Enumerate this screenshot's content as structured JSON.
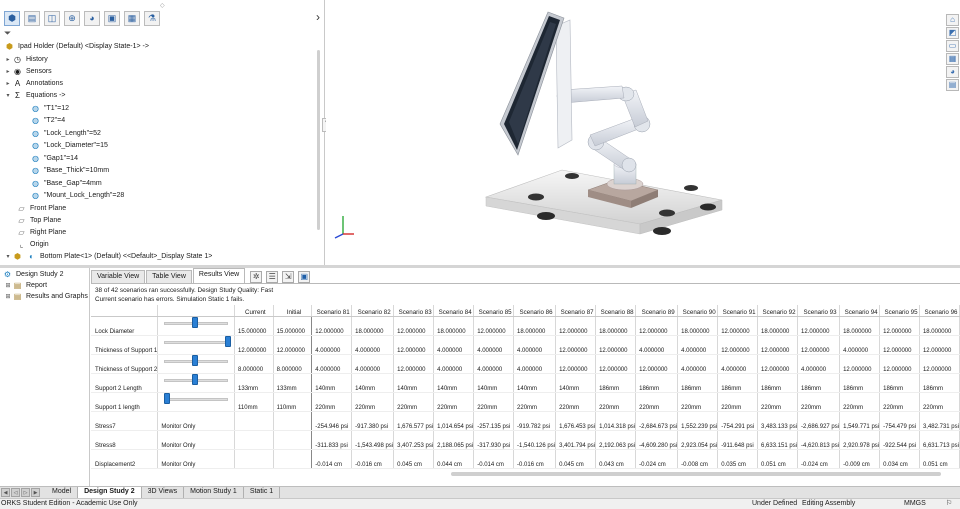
{
  "feature_manager": {
    "root_label": "Ipad Holder (Default) <Display State-1> ->",
    "nodes": [
      {
        "label": "History",
        "icon": "history-icon",
        "expandable": true
      },
      {
        "label": "Sensors",
        "icon": "sensors-icon",
        "expandable": true
      },
      {
        "label": "Annotations",
        "icon": "annotations-icon",
        "expandable": true
      },
      {
        "label": "Equations ->",
        "icon": "equations-icon",
        "expandable": true,
        "expanded": true
      }
    ],
    "equations": [
      "\"T1\"=12",
      "\"T2\"=4",
      "\"Lock_Length\"=52",
      "\"Lock_Diameter\"=15",
      "\"Gap1\"=14",
      "\"Base_Thick\"=10mm",
      "\"Base_Gap\"=4mm",
      "\"Mount_Lock_Length\"=28"
    ],
    "planes": [
      "Front Plane",
      "Top Plane",
      "Right Plane"
    ],
    "origin_label": "Origin",
    "component_label": "Bottom Plate<1> (Default) <<Default>_Display State 1>"
  },
  "study_tree": {
    "title": "Design Study 2",
    "items": [
      "Report",
      "Results and Graphs"
    ]
  },
  "results": {
    "tabs": [
      "Variable View",
      "Table View",
      "Results View"
    ],
    "active_tab": "Results View",
    "status_line1": "38 of 42 scenarios ran successfully. Design Study Quality: Fast",
    "status_line2": "Current scenario has errors. Simulation Static 1 fails.",
    "columns": [
      "Current",
      "Initial",
      "Scenario 81",
      "Scenario 82",
      "Scenario 83",
      "Scenario 84",
      "Scenario 85",
      "Scenario 86",
      "Scenario 87",
      "Scenario 88",
      "Scenario 89",
      "Scenario 90",
      "Scenario 91",
      "Scenario 92",
      "Scenario 93",
      "Scenario 94",
      "Scenario 95",
      "Scenario 96"
    ],
    "rows": [
      {
        "name": "Lock Diameter",
        "slider_fraction": 0.45,
        "current": "15.000000",
        "initial": "15.000000",
        "values": [
          "12.000000",
          "18.000000",
          "12.000000",
          "18.000000",
          "12.000000",
          "18.000000",
          "12.000000",
          "18.000000",
          "12.000000",
          "18.000000",
          "12.000000",
          "18.000000",
          "12.000000",
          "18.000000",
          "12.000000",
          "18.000000"
        ]
      },
      {
        "name": "Thickness of Support 1",
        "slider_fraction": 1.0,
        "current": "12.000000",
        "initial": "12.000000",
        "values": [
          "4.000000",
          "4.000000",
          "12.000000",
          "4.000000",
          "4.000000",
          "4.000000",
          "12.000000",
          "12.000000",
          "4.000000",
          "4.000000",
          "12.000000",
          "12.000000",
          "12.000000",
          "4.000000",
          "12.000000",
          "12.000000"
        ]
      },
      {
        "name": "Thickness of Support 2",
        "slider_fraction": 0.45,
        "current": "8.000000",
        "initial": "8.000000",
        "values": [
          "4.000000",
          "4.000000",
          "12.000000",
          "4.000000",
          "4.000000",
          "4.000000",
          "12.000000",
          "12.000000",
          "12.000000",
          "4.000000",
          "4.000000",
          "12.000000",
          "4.000000",
          "12.000000",
          "12.000000",
          "12.000000"
        ]
      },
      {
        "name": "Support 2 Length",
        "slider_fraction": 0.45,
        "current": "133mm",
        "initial": "133mm",
        "values": [
          "140mm",
          "140mm",
          "140mm",
          "140mm",
          "140mm",
          "140mm",
          "140mm",
          "186mm",
          "186mm",
          "186mm",
          "186mm",
          "186mm",
          "186mm",
          "186mm",
          "186mm",
          "186mm"
        ]
      },
      {
        "name": "Support 1 length",
        "slider_fraction": 0.0,
        "current": "110mm",
        "initial": "110mm",
        "values": [
          "220mm",
          "220mm",
          "220mm",
          "220mm",
          "220mm",
          "220mm",
          "220mm",
          "220mm",
          "220mm",
          "220mm",
          "220mm",
          "220mm",
          "220mm",
          "220mm",
          "220mm",
          "220mm"
        ]
      },
      {
        "name": "Stress7",
        "monitor": "Monitor Only",
        "current": "",
        "initial": "",
        "values": [
          "-254.946 psi",
          "-917.380 psi",
          "1,676.577 psi",
          "1,014.654 psi",
          "-257.135 psi",
          "-919.782 psi",
          "1,676.453 psi",
          "1,014.318 psi",
          "-2,684.673 psi",
          "1,552.239 psi",
          "-754.291 psi",
          "3,483.133 psi",
          "-2,686.927 psi",
          "1,549.771 psi",
          "-754.479 psi",
          "3,482.731 psi"
        ]
      },
      {
        "name": "Stress8",
        "monitor": "Monitor Only",
        "current": "",
        "initial": "",
        "values": [
          "-311.833 psi",
          "-1,543.498 psi",
          "3,407.253 psi",
          "2,188.065 psi",
          "-317.930 psi",
          "-1,540.126 psi",
          "3,401.794 psi",
          "2,192.063 psi",
          "-4,609.280 psi",
          "2,923.054 psi",
          "-911.648 psi",
          "6,633.151 psi",
          "-4,620.813 psi",
          "2,920.978 psi",
          "-922.544 psi",
          "6,631.713 psi"
        ]
      },
      {
        "name": "Displacement2",
        "monitor": "Monitor Only",
        "current": "",
        "initial": "",
        "values": [
          "-0.014 cm",
          "-0.016 cm",
          "0.045 cm",
          "0.044 cm",
          "-0.014 cm",
          "-0.016 cm",
          "0.045 cm",
          "0.043 cm",
          "-0.024 cm",
          "-0.008 cm",
          "0.035 cm",
          "0.051 cm",
          "-0.024 cm",
          "-0.009 cm",
          "0.034 cm",
          "0.051 cm"
        ]
      }
    ]
  },
  "bottom_tabs": [
    "Model",
    "Design Study 2",
    "3D Views",
    "Motion Study 1",
    "Static 1"
  ],
  "active_bottom_tab": "Design Study 2",
  "status_bar": {
    "left": "ORKS Student Edition - Academic Use Only",
    "middle1": "Under Defined",
    "middle2": "Editing Assembly",
    "units": "MMGS"
  },
  "colors": {
    "accent": "#2a7fd4",
    "tablet_screen": "#1e2733",
    "arm": "#d9dde6"
  }
}
